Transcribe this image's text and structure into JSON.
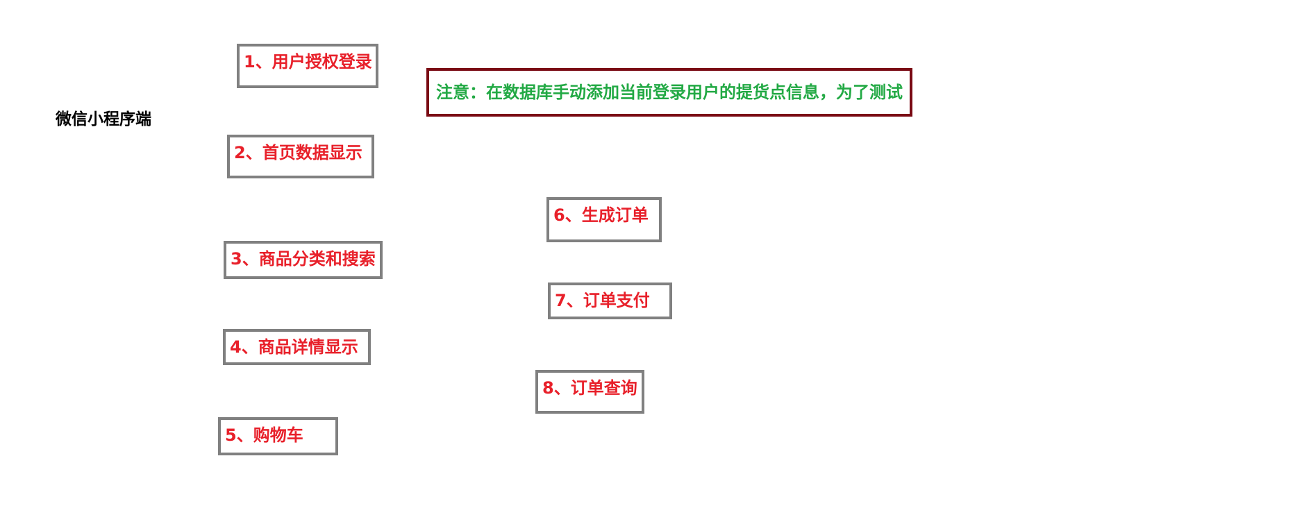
{
  "diagram": {
    "title": "微信小程序端",
    "note": "注意：在数据库手动添加当前登录用户的提货点信息，为了测试",
    "steps": [
      {
        "label": "1、用户授权登录"
      },
      {
        "label": "2、首页数据显示"
      },
      {
        "label": "3、商品分类和搜索"
      },
      {
        "label": "4、商品详情显示"
      },
      {
        "label": "5、购物车"
      },
      {
        "label": "6、生成订单"
      },
      {
        "label": "7、订单支付"
      },
      {
        "label": "8、订单查询"
      }
    ]
  },
  "colors": {
    "step_text": "#e8202a",
    "step_border": "#808080",
    "note_text": "#22a944",
    "note_border": "#7a0a14"
  }
}
